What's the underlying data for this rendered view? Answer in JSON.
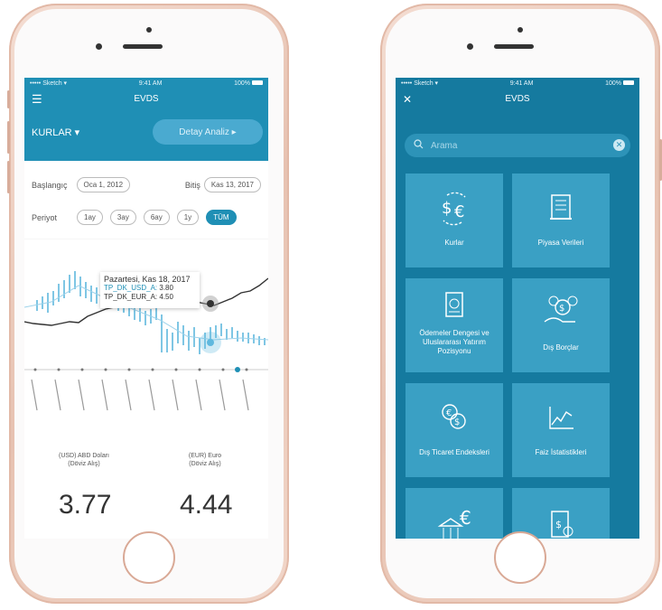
{
  "left": {
    "status": {
      "carrier": "••••• Sketch ▾",
      "time": "9:41 AM",
      "battery": "100%"
    },
    "nav": {
      "title": "EVDS",
      "menu_icon": "hamburger-icon"
    },
    "kurlar_label": "KURLAR ▾",
    "detay_label": "Detay Analiz ▸",
    "baslangic_label": "Başlangıç",
    "baslangic_value": "Oca 1, 2012",
    "bitis_label": "Bitiş",
    "bitis_value": "Kas 13, 2017",
    "periyot_label": "Periyot",
    "periods": [
      "1ay",
      "3ay",
      "6ay",
      "1y",
      "TÜM"
    ],
    "active_period": "TÜM",
    "tooltip": {
      "date": "Pazartesi, Kas 18, 2017",
      "usd_label": "TP_DK_USD_A:",
      "usd_value": "3.80",
      "eur_label": "TP_DK_EUR_A:",
      "eur_value": "4.50"
    },
    "usd_name": "(USD) ABD Doları",
    "usd_sub": "(Döviz Alış)",
    "eur_name": "(EUR) Euro",
    "eur_sub": "(Döviz Alış)",
    "usd_big": "3.77",
    "eur_big": "4.44"
  },
  "right": {
    "status": {
      "carrier": "••••• Sketch ▾",
      "time": "9:41 AM",
      "battery": "100%"
    },
    "nav": {
      "title": "EVDS",
      "close_icon": "close-icon"
    },
    "search_placeholder": "Arama",
    "tiles": [
      {
        "label": "Kurlar",
        "icon": "currency-exchange-icon"
      },
      {
        "label": "Piyasa Verileri",
        "icon": "scroll-document-icon"
      },
      {
        "label": "Ödemeler Dengesi ve Uluslararası Yatırım Pozisyonu",
        "icon": "passport-icon"
      },
      {
        "label": "Dış Borçlar",
        "icon": "hand-coins-icon"
      },
      {
        "label": "Dış Ticaret Endeksleri",
        "icon": "euro-dollar-exchange-icon"
      },
      {
        "label": "Faiz İstatistikleri",
        "icon": "line-chart-icon"
      },
      {
        "label": "",
        "icon": "bank-euro-icon"
      },
      {
        "label": "",
        "icon": "invoice-search-icon"
      }
    ]
  },
  "colors": {
    "primary": "#1f8fb5",
    "dark_screen": "#157a9f",
    "tile": "#3aa0c4"
  }
}
